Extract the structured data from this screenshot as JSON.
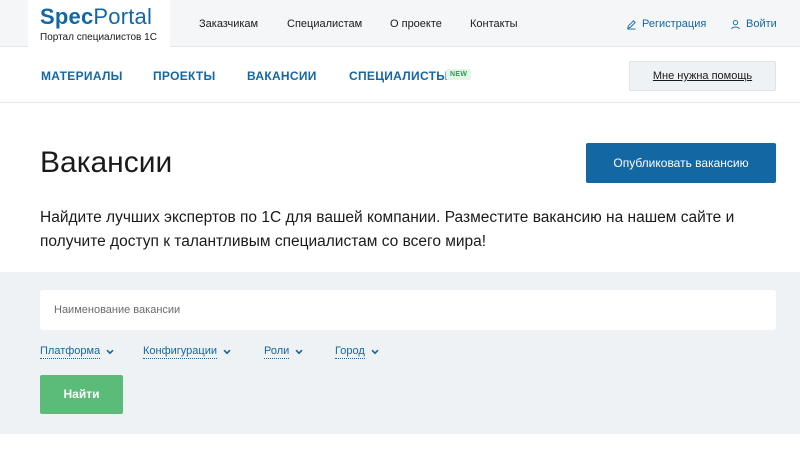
{
  "header": {
    "logo_spec": "Spec",
    "logo_portal": "Portal",
    "logo_subtitle": "Портал специалистов 1С",
    "nav": [
      "Заказчикам",
      "Специалистам",
      "О проекте",
      "Контакты"
    ],
    "register_label": "Регистрация",
    "login_label": "Войти"
  },
  "menu": {
    "items": [
      "МАТЕРИАЛЫ",
      "ПРОЕКТЫ",
      "ВАКАНСИИ",
      "СПЕЦИАЛИСТЫ"
    ],
    "new_badge": "NEW",
    "help_label": "Мне нужна помощь"
  },
  "main": {
    "title": "Вакансии",
    "publish_label": "Опубликовать вакансию",
    "intro": "Найдите лучших экспертов по 1С для вашей компании. Разместите вакансию на нашем сайте и получите доступ к талантливым специалистам со всего мира!"
  },
  "search": {
    "placeholder": "Наименование вакансии",
    "filters": [
      "Платформа",
      "Конфигурации",
      "Роли",
      "Город"
    ],
    "find_label": "Найти"
  },
  "colors": {
    "brand": "#1367a3",
    "find_button": "#5bbc7a",
    "search_bg": "#eef2f4",
    "topbar_bg": "#f4f6f8"
  },
  "icons": {
    "register": "pencil-icon",
    "login": "user-icon",
    "filter_toggle": "chevron-down-icon"
  }
}
